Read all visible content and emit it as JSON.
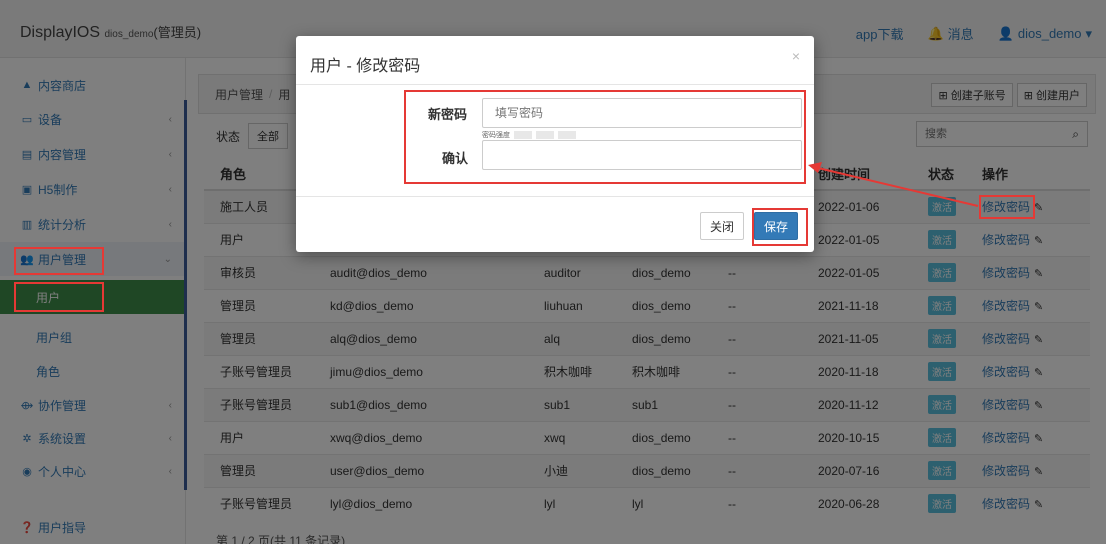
{
  "app": {
    "brand": "DisplayIOS",
    "tenant": "dios_demo",
    "role": "(管理员)",
    "topnav": {
      "download": "app下载",
      "messages": "消息",
      "user": "dios_demo"
    }
  },
  "sidebar": {
    "items": [
      {
        "label": "内容商店"
      },
      {
        "label": "设备"
      },
      {
        "label": "内容管理"
      },
      {
        "label": "H5制作"
      },
      {
        "label": "统计分析"
      },
      {
        "label": "用户管理"
      },
      {
        "label": "用户"
      },
      {
        "label": "用户组"
      },
      {
        "label": "角色"
      },
      {
        "label": "协作管理"
      },
      {
        "label": "系统设置"
      },
      {
        "label": "个人中心"
      },
      {
        "label": "用户指导"
      }
    ]
  },
  "breadcrumb": {
    "root": "用户管理",
    "current": "用"
  },
  "header_buttons": {
    "create_sub": "创建子账号",
    "create_user": "创建用户"
  },
  "filter": {
    "label": "状态",
    "selected": "全部"
  },
  "search": {
    "placeholder": "搜索"
  },
  "table": {
    "headers": [
      "角色",
      "",
      "",
      "",
      "",
      "创建时间",
      "状态",
      "操作"
    ],
    "rows": [
      [
        "施工人员",
        "",
        "",
        "",
        "",
        "2022-01-06",
        "激活",
        "修改密码"
      ],
      [
        "用户",
        "",
        "",
        "",
        "",
        "2022-01-05",
        "激活",
        "修改密码"
      ],
      [
        "审核员",
        "audit@dios_demo",
        "auditor",
        "dios_demo",
        "--",
        "2022-01-05",
        "激活",
        "修改密码"
      ],
      [
        "管理员",
        "kd@dios_demo",
        "liuhuan",
        "dios_demo",
        "--",
        "2021-11-18",
        "激活",
        "修改密码"
      ],
      [
        "管理员",
        "alq@dios_demo",
        "alq",
        "dios_demo",
        "--",
        "2021-11-05",
        "激活",
        "修改密码"
      ],
      [
        "子账号管理员",
        "jimu@dios_demo",
        "积木咖啡",
        "积木咖啡",
        "--",
        "2020-11-18",
        "激活",
        "修改密码"
      ],
      [
        "子账号管理员",
        "sub1@dios_demo",
        "sub1",
        "sub1",
        "--",
        "2020-11-12",
        "激活",
        "修改密码"
      ],
      [
        "用户",
        "xwq@dios_demo",
        "xwq",
        "dios_demo",
        "--",
        "2020-10-15",
        "激活",
        "修改密码"
      ],
      [
        "管理员",
        "user@dios_demo",
        "小迪",
        "dios_demo",
        "--",
        "2020-07-16",
        "激活",
        "修改密码"
      ],
      [
        "子账号管理员",
        "lyl@dios_demo",
        "lyl",
        "lyl",
        "--",
        "2020-06-28",
        "激活",
        "修改密码"
      ]
    ]
  },
  "pager": {
    "text": "第 1 / 2 页(共 11 条记录)"
  },
  "modal": {
    "title": "用户 - 修改密码",
    "close_glyph": "×",
    "new_password_label": "新密码",
    "new_password_placeholder": "填写密码",
    "strength_label": "密码强度",
    "confirm_label": "确认",
    "btn_close": "关闭",
    "btn_save": "保存"
  },
  "colors": {
    "annotation": "#e53935",
    "accent": "#337ab7",
    "active": "#3f8f4a",
    "badge": "#5bc0de"
  }
}
